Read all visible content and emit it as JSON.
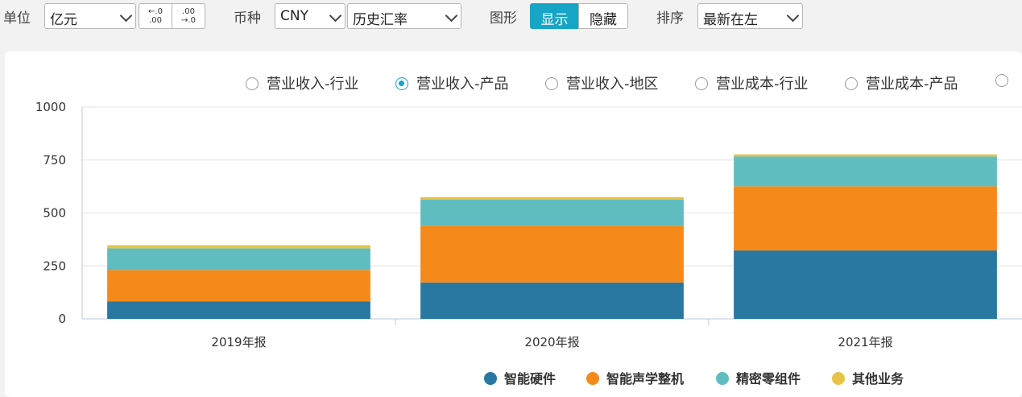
{
  "toolbar": {
    "unit_label": "单位",
    "unit_value": "亿元",
    "dec_less": "←.0\n.00",
    "dec_more": ".00\n→.0",
    "currency_label": "币种",
    "currency_value": "CNY",
    "rate_value": "历史汇率",
    "graph_label": "图形",
    "graph_show": "显示",
    "graph_hide": "隐藏",
    "sort_label": "排序",
    "sort_value": "最新在左"
  },
  "tabs": [
    {
      "label": "营业收入-行业",
      "selected": false
    },
    {
      "label": "营业收入-产品",
      "selected": true
    },
    {
      "label": "营业收入-地区",
      "selected": false
    },
    {
      "label": "营业成本-行业",
      "selected": false
    },
    {
      "label": "营业成本-产品",
      "selected": false
    }
  ],
  "accent_color": "#16a5c6",
  "chart_data": {
    "type": "bar",
    "stacked": true,
    "categories": [
      "2019年报",
      "2020年报",
      "2021年报"
    ],
    "yticks": [
      0,
      250,
      500,
      750,
      1000
    ],
    "ylim": [
      0,
      1000
    ],
    "grid": true,
    "legend_position": "bottom",
    "series": [
      {
        "name": "智能硬件",
        "color": "#2878a2",
        "values": [
          83,
          172,
          323
        ]
      },
      {
        "name": "智能声学整机",
        "color": "#f5891a",
        "values": [
          148,
          268,
          303
        ]
      },
      {
        "name": "精密零组件",
        "color": "#5fbdbf",
        "values": [
          102,
          123,
          141
        ]
      },
      {
        "name": "其他业务",
        "color": "#e6c347",
        "values": [
          15,
          12,
          10
        ]
      }
    ]
  }
}
